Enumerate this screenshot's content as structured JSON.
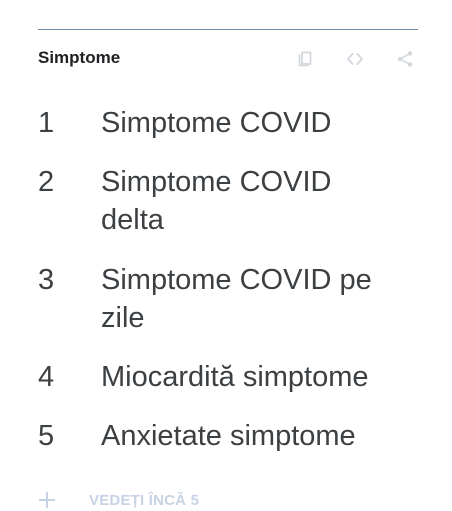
{
  "widget": {
    "title": "Simptome",
    "actions": [
      {
        "name": "copy-icon"
      },
      {
        "name": "embed-code-icon"
      },
      {
        "name": "share-icon"
      }
    ]
  },
  "items": [
    {
      "rank": "1",
      "label": "Simptome COVID"
    },
    {
      "rank": "2",
      "label": "Simptome COVID delta"
    },
    {
      "rank": "3",
      "label": "Simptome COVID pe zile"
    },
    {
      "rank": "4",
      "label": "Miocardită simptome"
    },
    {
      "rank": "5",
      "label": "Anxietate simptome"
    }
  ],
  "more": {
    "label": "VEDEȚI ÎNCĂ 5",
    "icon": "plus-icon"
  },
  "colors": {
    "top_rule": "#6f8fb1",
    "text": "#3c4043",
    "title": "#202124",
    "muted_action": "#c7d3e4"
  }
}
